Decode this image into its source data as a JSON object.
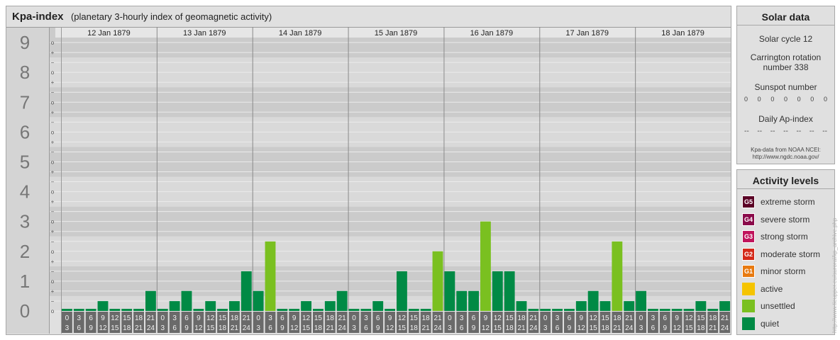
{
  "main": {
    "title": "Kpa-index",
    "subtitle": "(planetary 3-hourly index of geomagnetic activity)"
  },
  "solar": {
    "title": "Solar data",
    "cycle": "Solar cycle 12",
    "rotation_line1": "Carrington rotation",
    "rotation_line2": "number 338",
    "sunspot_label": "Sunspot number",
    "sunspot_values": [
      "0",
      "0",
      "0",
      "0",
      "0",
      "0",
      "0"
    ],
    "ap_label": "Daily Ap-index",
    "ap_values": [
      "--",
      "--",
      "--",
      "--",
      "--",
      "--",
      "--"
    ],
    "source_line1": "Kpa-data from NOAA NCEI:",
    "source_line2": "http://www.ngdc.noaa.gov/"
  },
  "levels": {
    "title": "Activity levels",
    "items": [
      {
        "badge": "G5",
        "label": "extreme storm",
        "color": "#5a0025"
      },
      {
        "badge": "G4",
        "label": "severe storm",
        "color": "#8a0a4a"
      },
      {
        "badge": "G3",
        "label": "strong storm",
        "color": "#c0145c"
      },
      {
        "badge": "G2",
        "label": "moderate storm",
        "color": "#d42a1a"
      },
      {
        "badge": "G1",
        "label": "minor storm",
        "color": "#e87a10"
      },
      {
        "badge": "",
        "label": "active",
        "color": "#f5c400"
      },
      {
        "badge": "",
        "label": "unsettled",
        "color": "#7ac020"
      },
      {
        "badge": "",
        "label": "quiet",
        "color": "#008a45"
      }
    ]
  },
  "watermark": "http://www.tieupper.eu/auroral/kp_archive.php",
  "colors": {
    "quiet": "#008a45",
    "unsettled": "#7ac020",
    "active": "#f5c400",
    "band_dark": "#cbcbcb",
    "band_light": "#d9d9d9",
    "slot": "#6a6a6a"
  },
  "chart_data": {
    "type": "bar",
    "title": "Kpa-index",
    "subtitle": "(planetary 3-hourly index of geomagnetic activity)",
    "ylim": [
      0,
      9
    ],
    "y_ticks": [
      "0",
      "1",
      "2",
      "3",
      "4",
      "5",
      "6",
      "7",
      "8",
      "9"
    ],
    "minor_tick_labels": [
      "o",
      "−",
      "+",
      "o",
      "−",
      "+",
      "o",
      "−",
      "+",
      "o",
      "−",
      "+",
      "o",
      "−",
      "+",
      "o",
      "−",
      "+",
      "o",
      "−",
      "+",
      "o",
      "−",
      "+",
      "o",
      "−",
      "+",
      "o"
    ],
    "days": [
      "12 Jan 1879",
      "13 Jan 1879",
      "14 Jan 1879",
      "15 Jan 1879",
      "16 Jan 1879",
      "17 Jan 1879",
      "18 Jan 1879"
    ],
    "interval_starts": [
      "0",
      "3",
      "6",
      "9",
      "12",
      "15",
      "18",
      "21"
    ],
    "interval_ends": [
      "3",
      "6",
      "9",
      "12",
      "15",
      "18",
      "21",
      "24"
    ],
    "values": [
      [
        0,
        0,
        0,
        0.33,
        0,
        0,
        0,
        0.67
      ],
      [
        0,
        0.33,
        0.67,
        0,
        0.33,
        0,
        0.33,
        1.33
      ],
      [
        0.67,
        2.33,
        0,
        0,
        0.33,
        0,
        0.33,
        0.67
      ],
      [
        0,
        0,
        0.33,
        0,
        1.33,
        0,
        0,
        2
      ],
      [
        1.33,
        0.67,
        0.67,
        3,
        1.33,
        1.33,
        0.33,
        0
      ],
      [
        0,
        0,
        0,
        0.33,
        0.67,
        0.33,
        2.33,
        0.33
      ],
      [
        0.67,
        0,
        0,
        0,
        0,
        0.33,
        0,
        0.33
      ]
    ],
    "legend": "right"
  }
}
